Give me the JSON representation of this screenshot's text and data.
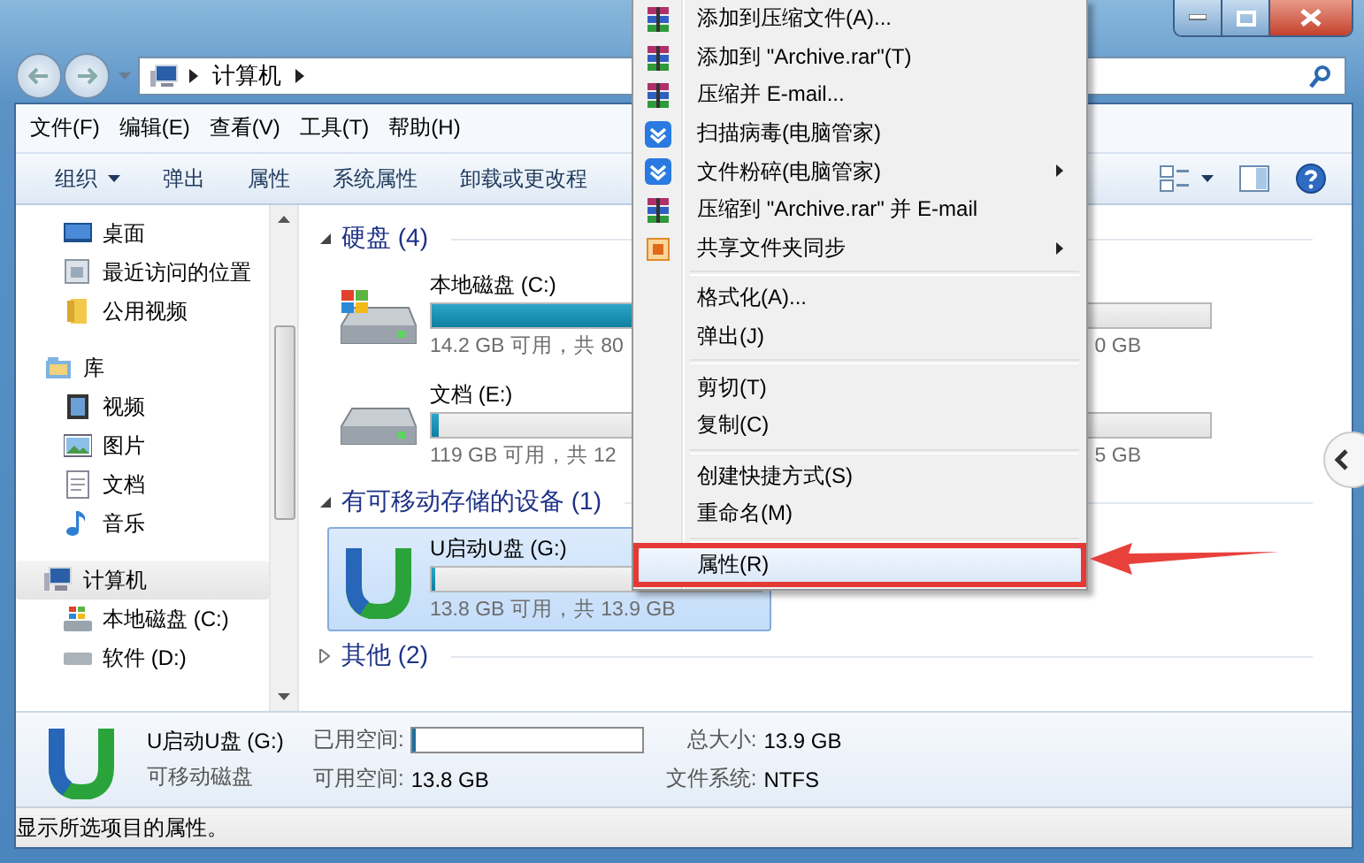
{
  "address_bar": {
    "path": [
      "计算机"
    ]
  },
  "menu_bar": [
    "文件(F)",
    "编辑(E)",
    "查看(V)",
    "工具(T)",
    "帮助(H)"
  ],
  "toolbar": [
    {
      "label": "组织",
      "dropdown": true
    },
    {
      "label": "弹出",
      "dropdown": false
    },
    {
      "label": "属性",
      "dropdown": false
    },
    {
      "label": "系统属性",
      "dropdown": false
    },
    {
      "label": "卸载或更改程",
      "dropdown": false
    }
  ],
  "sidebar": {
    "groups": [
      {
        "children": [
          {
            "label": "桌面",
            "kind": "desktop",
            "selected": false
          },
          {
            "label": "最近访问的位置",
            "kind": "recent",
            "selected": false
          },
          {
            "label": "公用视频",
            "kind": "folder",
            "selected": false
          }
        ]
      },
      {
        "label": "库",
        "kind": "library",
        "selected": false,
        "children": [
          {
            "label": "视频",
            "kind": "video",
            "selected": false
          },
          {
            "label": "图片",
            "kind": "picture",
            "selected": false
          },
          {
            "label": "文档",
            "kind": "document",
            "selected": false
          },
          {
            "label": "音乐",
            "kind": "music",
            "selected": false
          }
        ]
      },
      {
        "label": "计算机",
        "kind": "computer",
        "selected": true,
        "children": [
          {
            "label": "本地磁盘 (C:)",
            "kind": "system_drive",
            "selected": false
          },
          {
            "label": "软件 (D:)",
            "kind": "drive",
            "selected": false
          }
        ]
      }
    ]
  },
  "sections": [
    {
      "title": "硬盘 (4)",
      "kind": "hdd",
      "expanded": true,
      "drives": [
        {
          "name": "本地磁盘 (C:)",
          "kind": "system",
          "level": 0.82,
          "free_text": "14.2 GB 可用，共 80",
          "free_text_right": "0 GB",
          "selected": false
        },
        {
          "name": "文档 (E:)",
          "kind": "hdd",
          "level": 0.01,
          "free_text": "119 GB 可用，共 12",
          "free_text_right": "5 GB",
          "selected": false
        }
      ]
    },
    {
      "title": "有可移动存储的设备 (1)",
      "kind": "removable",
      "expanded": true,
      "drives": [
        {
          "name": "U启动U盘 (G:)",
          "kind": "usb",
          "level": 0.01,
          "free_text": "13.8 GB 可用，共 13.9 GB",
          "selected": true
        }
      ]
    },
    {
      "title": "其他 (2)",
      "expanded": false
    }
  ],
  "context_menu": {
    "groups": [
      [
        {
          "label": "添加到压缩文件(A)...",
          "kind": "rar",
          "submenu": false,
          "selected": false
        },
        {
          "label": "添加到 \"Archive.rar\"(T)",
          "kind": "rar",
          "submenu": false,
          "selected": false
        },
        {
          "label": "压缩并 E-mail...",
          "kind": "rar",
          "submenu": false,
          "selected": false
        },
        {
          "label": "扫描病毒(电脑管家)",
          "kind": "shield",
          "submenu": false,
          "selected": false
        },
        {
          "label": "文件粉碎(电脑管家)",
          "kind": "shield",
          "submenu": true,
          "selected": false
        },
        {
          "label": "压缩到 \"Archive.rar\" 并 E-mail",
          "kind": "rar",
          "submenu": false,
          "selected": false
        },
        {
          "label": "共享文件夹同步",
          "kind": "sync",
          "submenu": true,
          "selected": false
        }
      ],
      [
        {
          "label": "格式化(A)...",
          "kind": "none",
          "submenu": false,
          "selected": false
        },
        {
          "label": "弹出(J)",
          "kind": "none",
          "submenu": false,
          "selected": false
        }
      ],
      [
        {
          "label": "剪切(T)",
          "kind": "none",
          "submenu": false,
          "selected": false
        },
        {
          "label": "复制(C)",
          "kind": "none",
          "submenu": false,
          "selected": false
        }
      ],
      [
        {
          "label": "创建快捷方式(S)",
          "kind": "none",
          "submenu": false,
          "selected": false
        },
        {
          "label": "重命名(M)",
          "kind": "none",
          "submenu": false,
          "selected": false
        }
      ],
      [
        {
          "label": "属性(R)",
          "kind": "none",
          "submenu": false,
          "selected": true
        }
      ]
    ]
  },
  "details": {
    "name": "U启动U盘 (G:)",
    "type": "可移动磁盘",
    "fields": [
      {
        "label": "已用空间:",
        "kind": "bar",
        "level": 0.01
      },
      {
        "label": "总大小:",
        "kind": "text",
        "value": "13.9 GB"
      },
      {
        "label": "可用空间:",
        "kind": "text",
        "value": "13.8 GB"
      },
      {
        "label": "文件系统:",
        "kind": "text",
        "value": "NTFS"
      }
    ]
  },
  "status_bar": "显示所选项目的属性。"
}
